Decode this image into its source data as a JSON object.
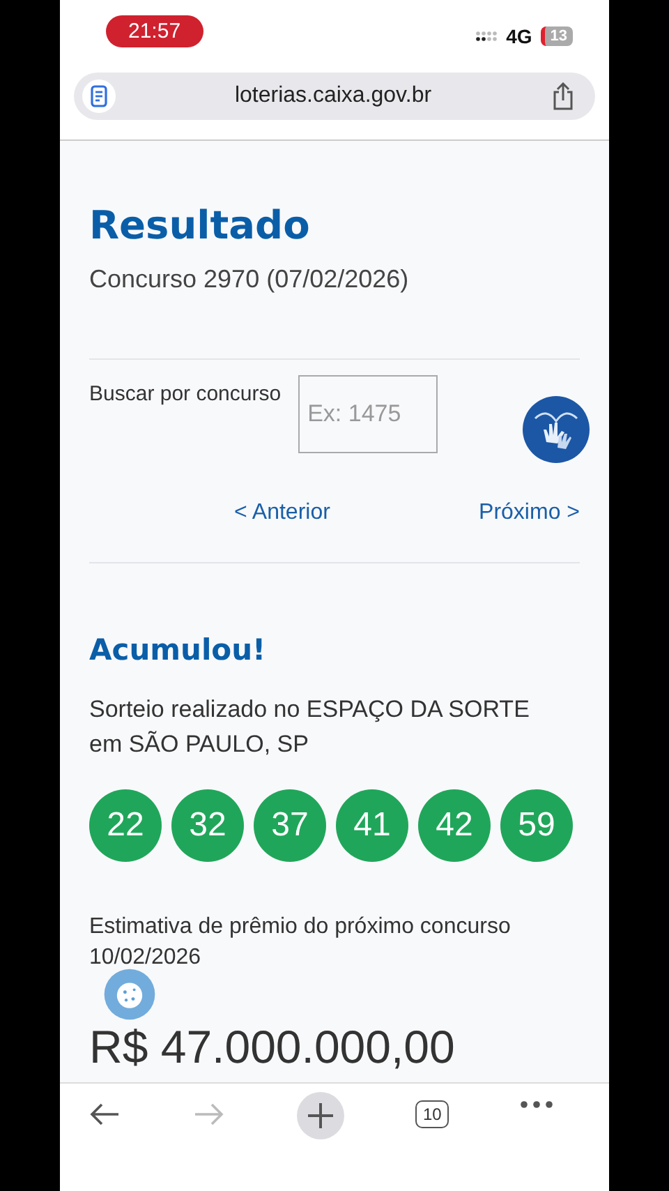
{
  "status_bar": {
    "time": "21:57",
    "network": "4G",
    "battery": "13"
  },
  "address_bar": {
    "url": "loterias.caixa.gov.br"
  },
  "result": {
    "title": "Resultado",
    "contest": "Concurso 2970 (07/02/2026)"
  },
  "search": {
    "label": "Buscar por concurso",
    "placeholder": "Ex: 1475"
  },
  "nav": {
    "previous": "< Anterior",
    "next": "Próximo >"
  },
  "draw": {
    "heading": "Acumulou!",
    "place": "Sorteio realizado no ESPAÇO DA SORTE em SÃO PAULO, SP",
    "numbers": [
      "22",
      "32",
      "37",
      "41",
      "42",
      "59"
    ]
  },
  "estimate": {
    "label": "Estimativa de prêmio do próximo concurso",
    "date": "10/02/2026",
    "amount": "R$ 47.000.000,00"
  },
  "toolbar": {
    "back_disabled": false,
    "forward_disabled": true,
    "tabs": "10"
  }
}
